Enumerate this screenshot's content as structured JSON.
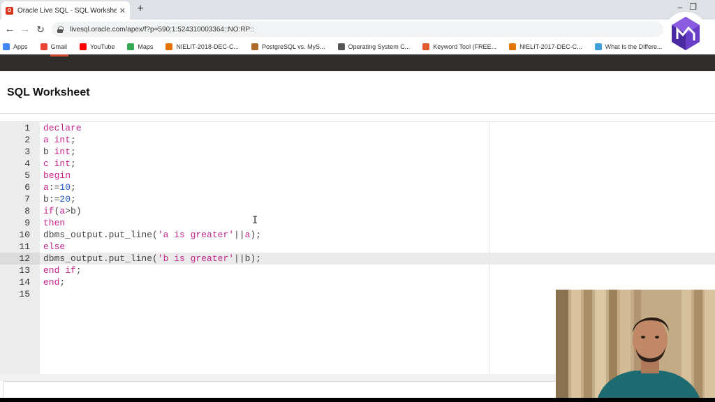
{
  "browser": {
    "tab_title": "Oracle Live SQL - SQL Worksheet",
    "tab_favicon": "oracle-favicon",
    "url": "livesql.oracle.com/apex/f?p=590:1:524310003364::NO:RP::",
    "bookmarks": [
      {
        "label": "Apps",
        "icon": "apps-grid-icon",
        "color": "#4285f4"
      },
      {
        "label": "Gmail",
        "icon": "gmail-icon",
        "color": "#ea4335"
      },
      {
        "label": "YouTube",
        "icon": "youtube-icon",
        "color": "#ff0000"
      },
      {
        "label": "Maps",
        "icon": "maps-pin-icon",
        "color": "#34a853"
      },
      {
        "label": "NIELIT-2018-DEC-C...",
        "icon": "bookmark-favicon",
        "color": "#e37400"
      },
      {
        "label": "PostgreSQL vs. MyS...",
        "icon": "bookmark-favicon",
        "color": "#b06b2b"
      },
      {
        "label": "Operating System C...",
        "icon": "bookmark-favicon",
        "color": "#555555"
      },
      {
        "label": "Keyword Tool (FREE...",
        "icon": "bookmark-favicon",
        "color": "#e25b2c"
      },
      {
        "label": "NIELIT-2017-DEC-C...",
        "icon": "bookmark-favicon",
        "color": "#e37400"
      },
      {
        "label": "What Is the Differe...",
        "icon": "bookmark-favicon",
        "color": "#3ea0d8"
      }
    ]
  },
  "page": {
    "title": "SQL Worksheet"
  },
  "editor": {
    "active_line": 12,
    "lines": [
      {
        "n": "1",
        "tokens": [
          {
            "t": "declare",
            "c": "kw"
          }
        ]
      },
      {
        "n": "2",
        "tokens": [
          {
            "t": "a ",
            "c": "kw"
          },
          {
            "t": "int",
            "c": "kw"
          },
          {
            "t": ";",
            "c": "op"
          }
        ]
      },
      {
        "n": "3",
        "tokens": [
          {
            "t": "b ",
            "c": "op"
          },
          {
            "t": "int",
            "c": "kw"
          },
          {
            "t": ";",
            "c": "op"
          }
        ]
      },
      {
        "n": "4",
        "tokens": [
          {
            "t": "c ",
            "c": "kw"
          },
          {
            "t": "int",
            "c": "kw"
          },
          {
            "t": ";",
            "c": "op"
          }
        ]
      },
      {
        "n": "5",
        "tokens": [
          {
            "t": "begin",
            "c": "kw"
          }
        ]
      },
      {
        "n": "6",
        "tokens": [
          {
            "t": "a",
            "c": "kw"
          },
          {
            "t": ":=",
            "c": "op"
          },
          {
            "t": "10",
            "c": "num"
          },
          {
            "t": ";",
            "c": "op"
          }
        ]
      },
      {
        "n": "7",
        "tokens": [
          {
            "t": "b",
            "c": "op"
          },
          {
            "t": ":=",
            "c": "op"
          },
          {
            "t": "20",
            "c": "num"
          },
          {
            "t": ";",
            "c": "op"
          }
        ]
      },
      {
        "n": "8",
        "tokens": [
          {
            "t": "if",
            "c": "kw"
          },
          {
            "t": "(",
            "c": "op"
          },
          {
            "t": "a",
            "c": "kw"
          },
          {
            "t": ">b)",
            "c": "op"
          }
        ]
      },
      {
        "n": "9",
        "tokens": [
          {
            "t": "then",
            "c": "kw"
          }
        ]
      },
      {
        "n": "10",
        "tokens": [
          {
            "t": "dbms_output.put_line(",
            "c": "op"
          },
          {
            "t": "'a is greater'",
            "c": "str"
          },
          {
            "t": "||",
            "c": "op"
          },
          {
            "t": "a",
            "c": "kw"
          },
          {
            "t": ");",
            "c": "op"
          }
        ]
      },
      {
        "n": "11",
        "tokens": [
          {
            "t": "else",
            "c": "kw"
          }
        ]
      },
      {
        "n": "12",
        "tokens": [
          {
            "t": "dbms_output.put_line(",
            "c": "op"
          },
          {
            "t": "'b is greater'",
            "c": "str"
          },
          {
            "t": "||b);",
            "c": "op"
          }
        ]
      },
      {
        "n": "13",
        "tokens": [
          {
            "t": "end if",
            "c": "kw"
          },
          {
            "t": ";",
            "c": "op"
          }
        ]
      },
      {
        "n": "14",
        "tokens": [
          {
            "t": "end",
            "c": "kw"
          },
          {
            "t": ";",
            "c": "op"
          }
        ]
      },
      {
        "n": "15",
        "tokens": []
      }
    ]
  },
  "colors": {
    "keyword": "#c5238b",
    "number": "#1f55c9",
    "oracle_red": "#c74634",
    "header_dark": "#312d2a"
  }
}
